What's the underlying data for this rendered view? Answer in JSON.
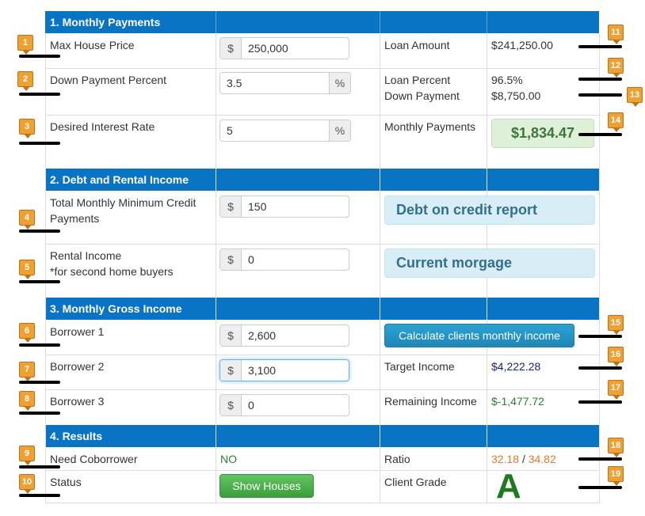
{
  "sections": {
    "monthly_payments": "1. Monthly Payments",
    "debt_rental": "2. Debt and Rental Income",
    "gross_income": "3. Monthly Gross Income",
    "results": "4. Results"
  },
  "rows": {
    "max_house_price": {
      "label": "Max House Price",
      "prefix": "$",
      "value": "250,000"
    },
    "down_payment_percent": {
      "label": "Down Payment Percent",
      "value": "3.5",
      "suffix": "%"
    },
    "interest_rate": {
      "label": "Desired Interest Rate",
      "value": "5",
      "suffix": "%"
    },
    "credit_payments": {
      "label_line1": "Total Monthly Minimum Credit",
      "label_line2": "Payments",
      "prefix": "$",
      "value": "150"
    },
    "rental_income": {
      "label_line1": "Rental Income",
      "label_line2": "*for second home buyers",
      "prefix": "$",
      "value": "0"
    },
    "borrower1": {
      "label": "Borrower 1",
      "prefix": "$",
      "value": "2,600"
    },
    "borrower2": {
      "label": "Borrower 2",
      "prefix": "$",
      "value": "3,100"
    },
    "borrower3": {
      "label": "Borrower 3",
      "prefix": "$",
      "value": "0"
    },
    "need_coborrower": {
      "label": "Need Coborrower",
      "value": "NO"
    },
    "status": {
      "label": "Status",
      "button": "Show Houses"
    }
  },
  "results": {
    "loan_amount_label": "Loan Amount",
    "loan_amount": "$241,250.00",
    "loan_percent_label": "Loan Percent",
    "loan_percent": "96.5%",
    "down_payment_label": "Down Payment",
    "down_payment": "$8,750.00",
    "monthly_payments_label": "Monthly Payments",
    "monthly_payments": "$1,834.47",
    "debt_button": "Debt on credit report",
    "mortgage_button": "Current morgage",
    "calc_button": "Calculate clients monthly income",
    "target_income_label": "Target Income",
    "target_income": "$4,222.28",
    "remaining_income_label": "Remaining Income",
    "remaining_income": "$-1,477.72",
    "ratio_label": "Ratio",
    "ratio_a": "32.18",
    "ratio_sep": "/",
    "ratio_b": "34.82",
    "client_grade_label": "Client Grade",
    "client_grade": "A"
  },
  "badges": [
    "1",
    "2",
    "3",
    "4",
    "5",
    "6",
    "7",
    "8",
    "9",
    "10",
    "11",
    "12",
    "13",
    "14",
    "15",
    "16",
    "17",
    "18",
    "19"
  ],
  "colors": {
    "header_blue": "#0a74c4",
    "badge_orange": "#f0a030",
    "green_text": "#2e7d32",
    "navy_text": "#1a237e",
    "orange_text": "#e8782a"
  }
}
